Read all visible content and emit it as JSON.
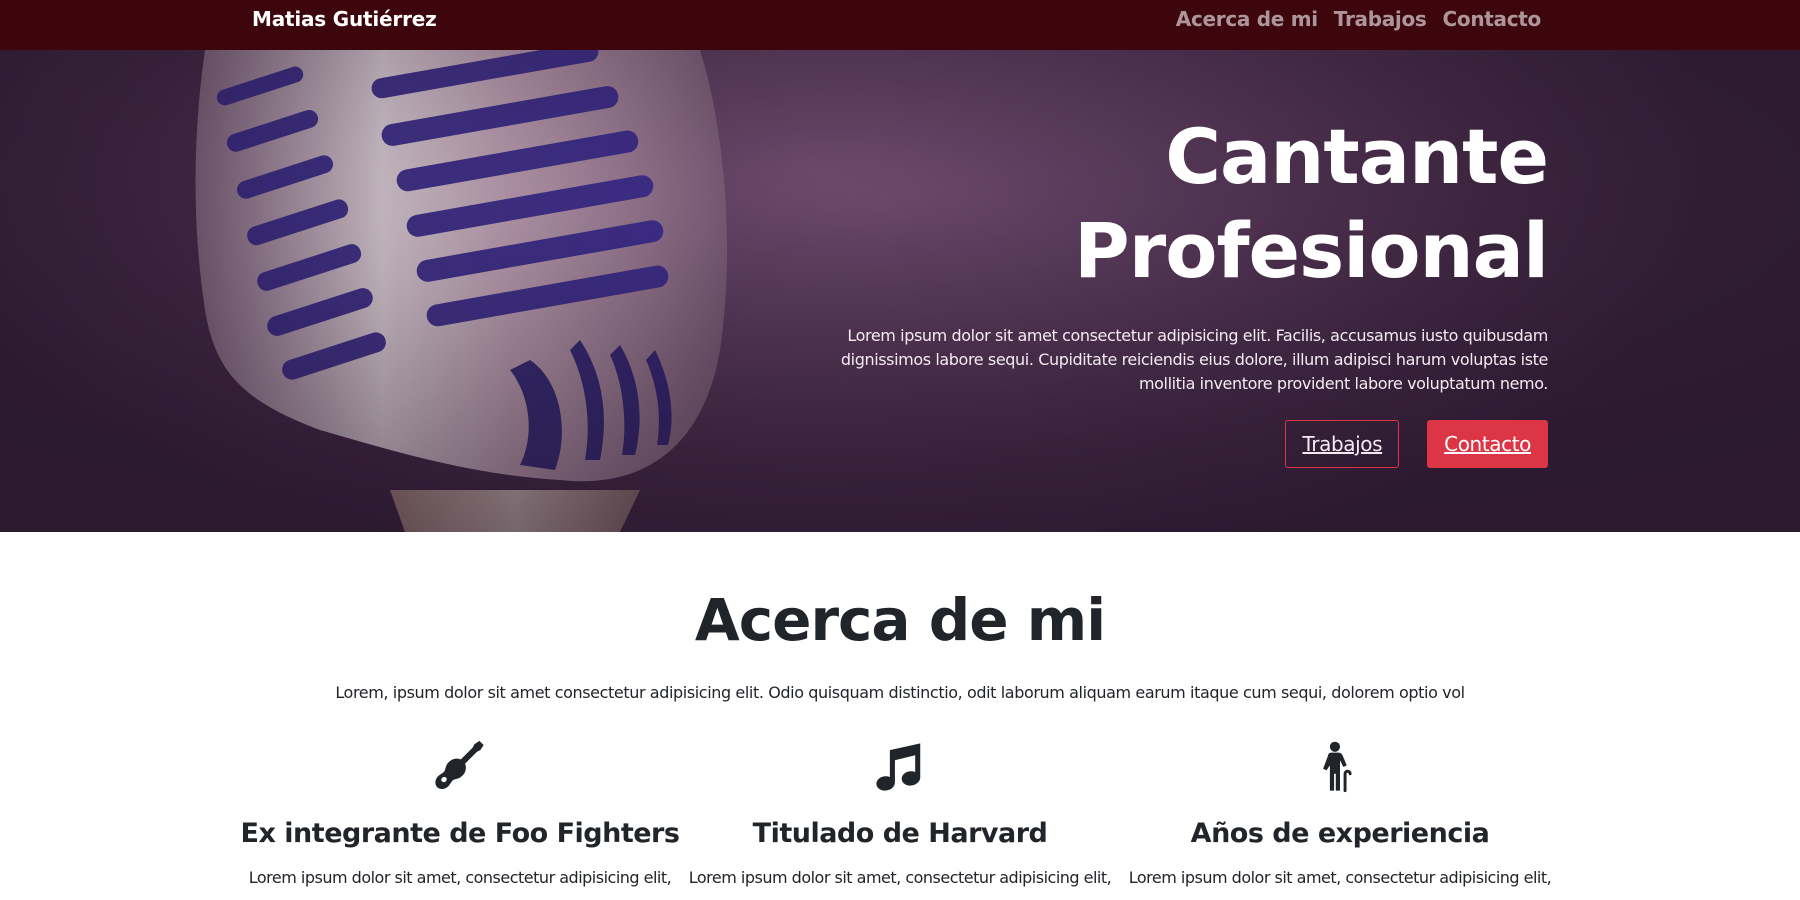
{
  "navbar": {
    "brand": "Matias Gutiérrez",
    "links": [
      "Acerca de mi",
      "Trabajos",
      "Contacto"
    ]
  },
  "hero": {
    "title_line1": "Cantante",
    "title_line2": "Profesional",
    "text": "Lorem ipsum dolor sit amet consectetur adipisicing elit. Facilis, accusamus iusto quibusdam dignissimos labore sequi. Cupiditate reiciendis eius dolore, illum adipisci harum voluptas iste mollitia inventore provident labore voluptatum nemo.",
    "buttons": {
      "primary_outline": "Trabajos",
      "primary_solid": "Contacto"
    }
  },
  "about": {
    "title": "Acerca de mi",
    "text": "Lorem, ipsum dolor sit amet consectetur adipisicing elit. Odio quisquam distinctio, odit laborum aliquam earum itaque cum sequi, dolorem optio vol",
    "features": [
      {
        "icon": "guitar-icon",
        "title": "Ex integrante de Foo Fighters",
        "text": "Lorem ipsum dolor sit amet, consectetur adipisicing elit,"
      },
      {
        "icon": "music-note-icon",
        "title": "Titulado de Harvard",
        "text": "Lorem ipsum dolor sit amet, consectetur adipisicing elit,"
      },
      {
        "icon": "person-cane-icon",
        "title": "Años de experiencia",
        "text": "Lorem ipsum dolor sit amet, consectetur adipisicing elit,"
      }
    ]
  },
  "colors": {
    "navbar_bg": "#3d060c",
    "accent": "#dc3545",
    "hero_bg": "#5a3a5c",
    "text_dark": "#212529"
  }
}
